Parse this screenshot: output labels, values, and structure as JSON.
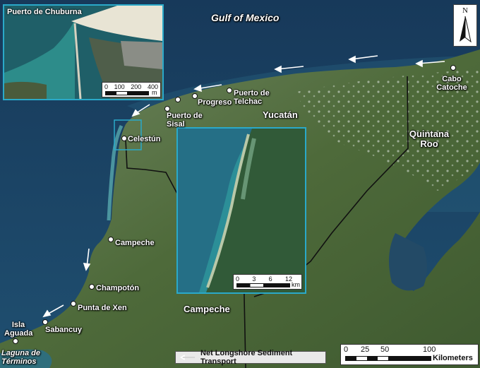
{
  "title_water": "Gulf of Mexico",
  "north_label": "N",
  "states": [
    "Yucatán",
    "Campeche",
    "Quintana Roo"
  ],
  "places": {
    "cabo_catoche": "Cabo Catoche",
    "puerto_telchac": "Puerto de Telchac",
    "progreso": "Progreso",
    "puerto_sisal": "Puerto de Sisal",
    "celestun": "Celestún",
    "campeche": "Campeche",
    "champoton": "Champotón",
    "punta_xen": "Punta de Xen",
    "sabancuy": "Sabancuy",
    "isla_aguada": "Isla Aguada",
    "laguna": "Laguna de Términos"
  },
  "inset_top": {
    "title": "Puerto de Chuburna",
    "scale_ticks": [
      "0",
      "100",
      "200",
      "400"
    ],
    "scale_unit": "m"
  },
  "inset_center": {
    "scale_ticks": [
      "0",
      "3",
      "6",
      "12"
    ],
    "scale_unit": "km"
  },
  "main_scale": {
    "ticks": [
      "0",
      "25",
      "50",
      "100"
    ],
    "unit": "Kilometers"
  },
  "legend": {
    "label": "Net Longshore Sediment Transport"
  },
  "colors": {
    "sea": "#1d4766",
    "land": "#4f6a3c",
    "inset_border": "#2aa9c9"
  }
}
